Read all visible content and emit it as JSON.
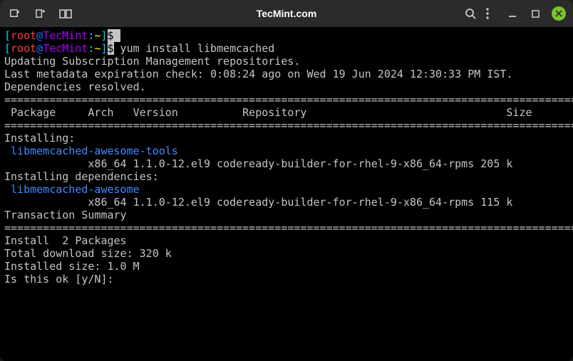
{
  "titlebar": {
    "title": "TecMint.com"
  },
  "term": {
    "prompt": {
      "lb": "[",
      "rb": "]",
      "user": "root",
      "at": "@",
      "host": "TecMint",
      "colon": ":",
      "path": "~",
      "dollar": "$",
      "inv": " "
    },
    "cmd": " yum install libmemcached",
    "l1": "Updating Subscription Management repositories.",
    "l2": "Last metadata expiration check: 0:08:24 ago on Wed 19 Jun 2024 12:30:33 PM IST.",
    "l3": "Dependencies resolved.",
    "sep": "================================================================================================",
    "hdr": " Package     Arch   Version          Repository                               Size",
    "installing": "Installing:",
    "pkg1": " libmemcached-awesome-tools",
    "pkg1d": "             x86_64 1.1.0-12.el9 codeready-builder-for-rhel-9-x86_64-rpms 205 k",
    "installdeps": "Installing dependencies:",
    "pkg2": " libmemcached-awesome",
    "pkg2d": "             x86_64 1.1.0-12.el9 codeready-builder-for-rhel-9-x86_64-rpms 115 k",
    "blank": "",
    "txsummary": "Transaction Summary",
    "installcount": "Install  2 Packages",
    "dlsize": "Total download size: 320 k",
    "instsize": "Installed size: 1.0 M",
    "confirm": "Is this ok [y/N]: "
  }
}
